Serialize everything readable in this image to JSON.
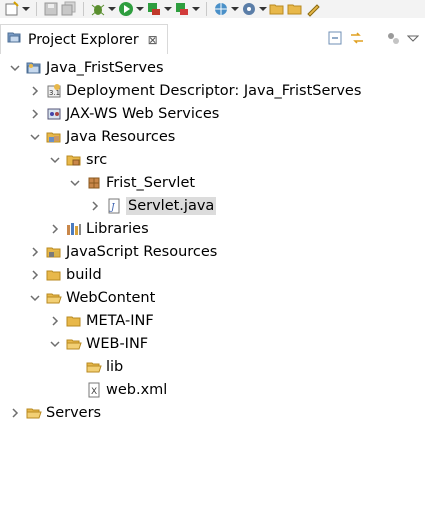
{
  "toolbar": {
    "icons": [
      "new-icon",
      "save-icon",
      "save-all-icon",
      "debug-icon",
      "run-icon",
      "coverage-icon",
      "external-tools-icon",
      "web-browser-icon",
      "server-icon",
      "open-folder-icon",
      "open-file-icon",
      "pencil-icon"
    ]
  },
  "view": {
    "title": "Project Explorer",
    "close_glyph": "⊠"
  },
  "tree": [
    {
      "label": "Java_FristServes",
      "icon": "project-icon",
      "expanded": true,
      "level": 0
    },
    {
      "label": "Deployment Descriptor: Java_FristServes",
      "icon": "deployment-descriptor-icon",
      "expanded": false,
      "level": 1
    },
    {
      "label": "JAX-WS Web Services",
      "icon": "web-services-icon",
      "expanded": false,
      "level": 1
    },
    {
      "label": "Java Resources",
      "icon": "java-resources-icon",
      "expanded": true,
      "level": 1
    },
    {
      "label": "src",
      "icon": "source-folder-icon",
      "expanded": true,
      "level": 2
    },
    {
      "label": "Frist_Servlet",
      "icon": "package-icon",
      "expanded": true,
      "level": 3
    },
    {
      "label": "Servlet.java",
      "icon": "java-file-icon",
      "expanded": false,
      "level": 4,
      "selected": true
    },
    {
      "label": "Libraries",
      "icon": "libraries-icon",
      "expanded": false,
      "level": 2
    },
    {
      "label": "JavaScript Resources",
      "icon": "javascript-resources-icon",
      "expanded": false,
      "level": 1
    },
    {
      "label": "build",
      "icon": "folder-icon",
      "expanded": false,
      "level": 1
    },
    {
      "label": "WebContent",
      "icon": "folder-open-icon",
      "expanded": true,
      "level": 1
    },
    {
      "label": "META-INF",
      "icon": "folder-icon",
      "expanded": false,
      "level": 2
    },
    {
      "label": "WEB-INF",
      "icon": "folder-open-icon",
      "expanded": true,
      "level": 2
    },
    {
      "label": "lib",
      "icon": "folder-open-icon",
      "expanded": null,
      "level": 3
    },
    {
      "label": "web.xml",
      "icon": "xml-file-icon",
      "expanded": null,
      "level": 3
    },
    {
      "label": "Servers",
      "icon": "folder-open-icon",
      "expanded": false,
      "level": 0
    }
  ],
  "colors": {
    "folder": "#e8b84a",
    "selection": "#dcdcdc",
    "twistie": "#6e6e6e"
  }
}
